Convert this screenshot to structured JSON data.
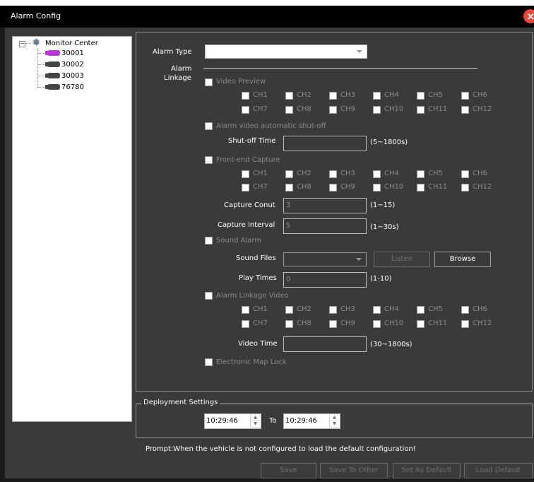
{
  "window": {
    "title": "Alarm Config",
    "close_glyph": "×"
  },
  "tree": {
    "root": "Monitor Center",
    "items": [
      {
        "label": "30001",
        "selected": true
      },
      {
        "label": "30002",
        "selected": false
      },
      {
        "label": "30003",
        "selected": false
      },
      {
        "label": "76780",
        "selected": false
      }
    ]
  },
  "form": {
    "alarm_type_label": "Alarm Type",
    "alarm_type_value": "",
    "alarm_linkage_label_1": "Alarm",
    "alarm_linkage_label_2": "Linkage",
    "video_preview": "Video Preview",
    "alarm_auto_shutoff": "Alarm video automatic shut-off",
    "shutoff_time_label": "Shut-off Time",
    "shutoff_time_value": "",
    "shutoff_time_range": "(5~1800s)",
    "front_end_capture": "Front-end Capture",
    "capture_count_label": "Capture Conut",
    "capture_count_value": "3",
    "capture_count_range": "(1~15)",
    "capture_interval_label": "Capture Interval",
    "capture_interval_value": "5",
    "capture_interval_range": "(1~30s)",
    "sound_alarm": "Sound Alarm",
    "sound_files_label": "Sound Files",
    "listen_button": "Listen",
    "browse_button": "Browse",
    "play_times_label": "Play Times",
    "play_times_value": "0",
    "play_times_range": "(1-10)",
    "alarm_linkage_video": "Alarm Linkage Video",
    "video_time_label": "Video Time",
    "video_time_value": "",
    "video_time_range": "(30~1800s)",
    "electronic_map_lock": "Electronic Map Lock"
  },
  "channels": [
    "CH1",
    "CH2",
    "CH3",
    "CH4",
    "CH5",
    "CH6",
    "CH7",
    "CH8",
    "CH9",
    "CH10",
    "CH11",
    "CH12"
  ],
  "deployment": {
    "title": "Deployment Settings",
    "start_time": "10:29:46",
    "to_label": "To",
    "end_time": "10:29:46"
  },
  "prompt": "Prompt:When the vehicle is not configured to load the default configuration!",
  "footer": {
    "save": "Save",
    "save_to_other": "Save To Other",
    "set_as_default": "Set As Default",
    "load_default": "Load Default"
  }
}
